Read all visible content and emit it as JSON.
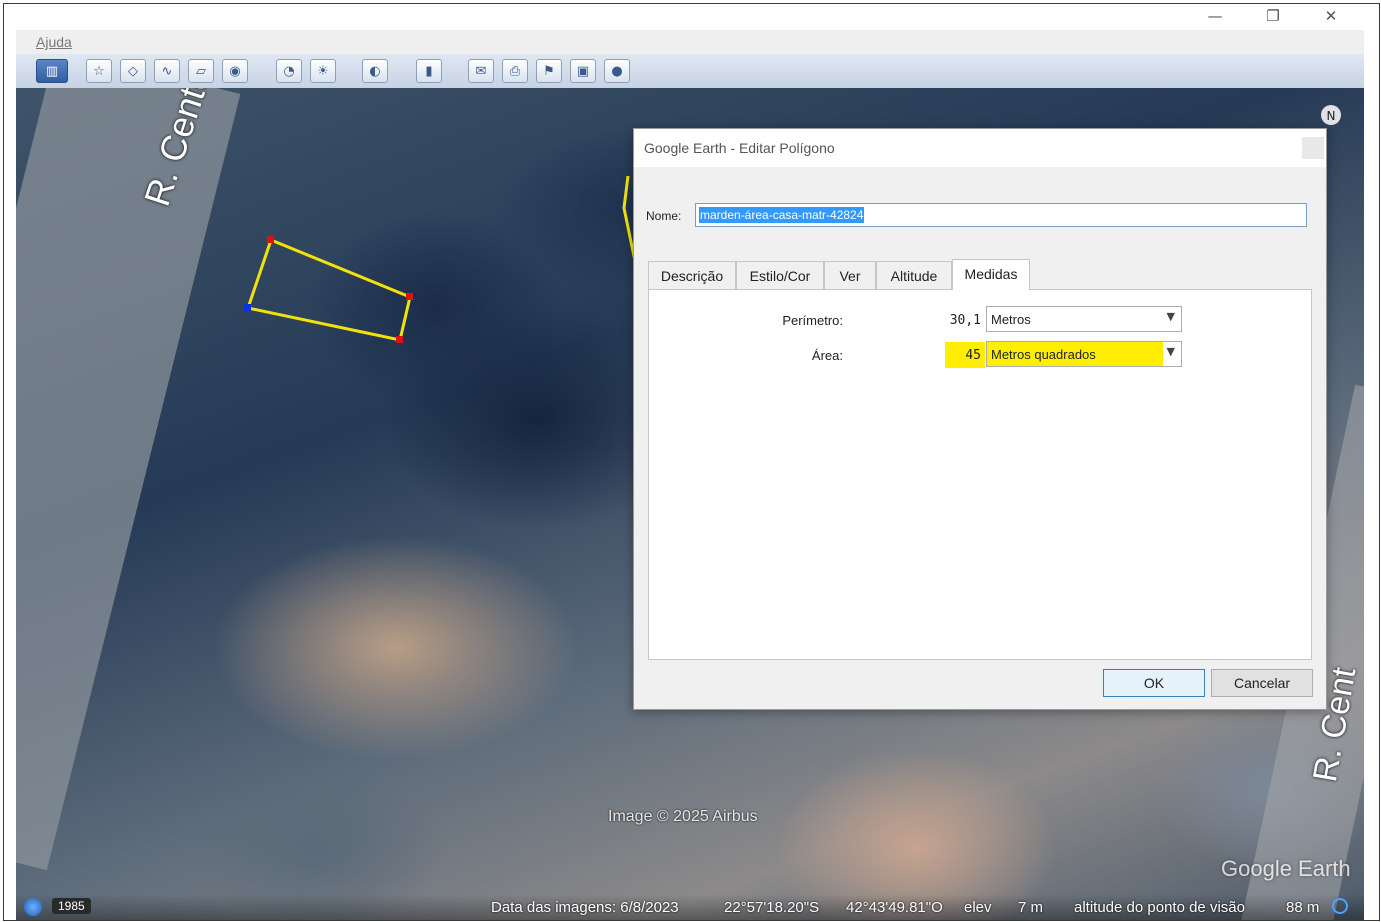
{
  "menu": {
    "help": "Ajuda"
  },
  "window_controls": {
    "minimize": "—",
    "restore": "❐",
    "close": "✕"
  },
  "map": {
    "street_left": "R. Cento e Tr",
    "street_right": "R. Cent",
    "compass": "N",
    "watermark": "Image © 2025 Airbus",
    "logo": "Google Earth"
  },
  "status": {
    "year": "1985",
    "imagery_date": "Data das imagens: 6/8/2023",
    "lat": "22°57'18.20\"S",
    "lon": "42°43'49.81\"O",
    "elev_label": "elev",
    "elev_value": "7 m",
    "eye_alt_label": "altitude do ponto de visão",
    "eye_alt_value": "88 m"
  },
  "dialog": {
    "title": "Google Earth - Editar Polígono",
    "name_label": "Nome:",
    "name_value": "marden-área-casa-matr-42824",
    "tabs": [
      "Descrição",
      "Estilo/Cor",
      "Ver",
      "Altitude",
      "Medidas"
    ],
    "active_tab": "Medidas",
    "perimeter_label": "Perímetro:",
    "perimeter_value": "30,1",
    "perimeter_unit": "Metros",
    "area_label": "Área:",
    "area_value": "45",
    "area_unit": "Metros quadrados",
    "ok": "OK",
    "cancel": "Cancelar"
  },
  "colors": {
    "polygon_line": "#f2e20a",
    "vertex": "#e01010",
    "vertex_selected": "#1030e0",
    "highlight": "#ffee00"
  }
}
